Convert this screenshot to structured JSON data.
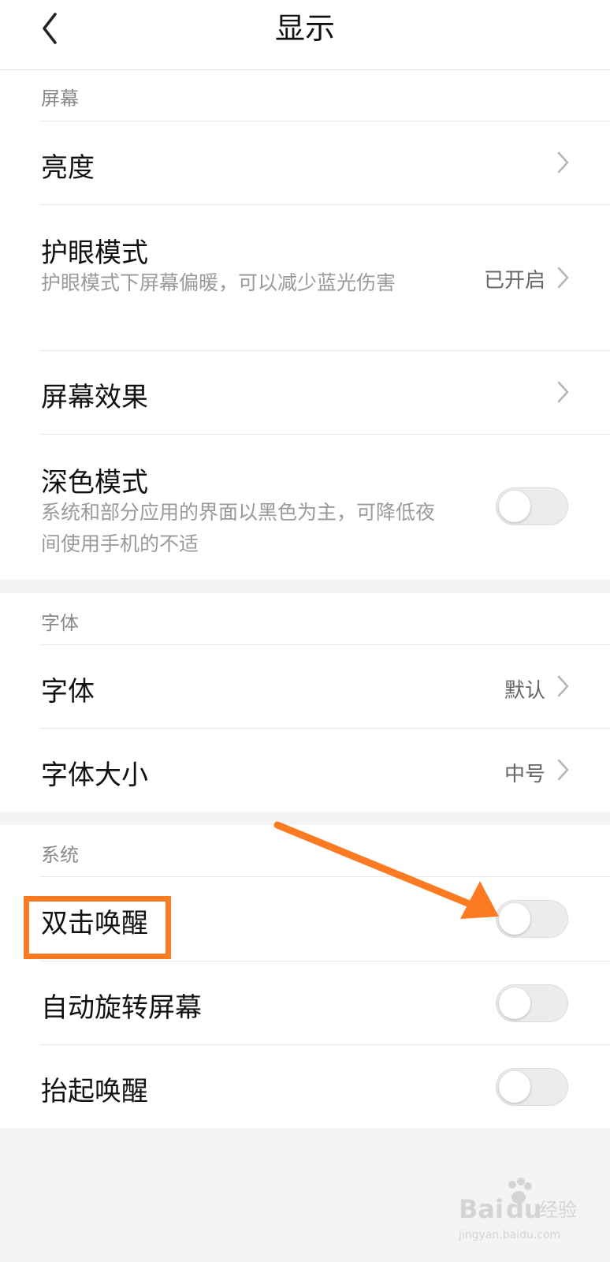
{
  "header": {
    "title": "显示"
  },
  "screen_section": {
    "header": "屏幕",
    "items": [
      {
        "title": "亮度"
      },
      {
        "title": "护眼模式",
        "description": "护眼模式下屏幕偏暖，可以减少蓝光伤害",
        "value": "已开启"
      },
      {
        "title": "屏幕效果"
      },
      {
        "title": "深色模式",
        "description": "系统和部分应用的界面以黑色为主，可降低夜间使用手机的不适",
        "toggle": false
      }
    ]
  },
  "font_section": {
    "header": "字体",
    "items": [
      {
        "title": "字体",
        "value": "默认"
      },
      {
        "title": "字体大小",
        "value": "中号"
      }
    ]
  },
  "system_section": {
    "header": "系统",
    "items": [
      {
        "title": "双击唤醒",
        "toggle": false
      },
      {
        "title": "自动旋转屏幕",
        "toggle": false
      },
      {
        "title": "抬起唤醒",
        "toggle": false
      }
    ]
  },
  "annotation": {
    "color": "#fb7a22"
  },
  "watermark": {
    "text": "Baidu经验",
    "subtext": "jingyan.baidu.com"
  }
}
